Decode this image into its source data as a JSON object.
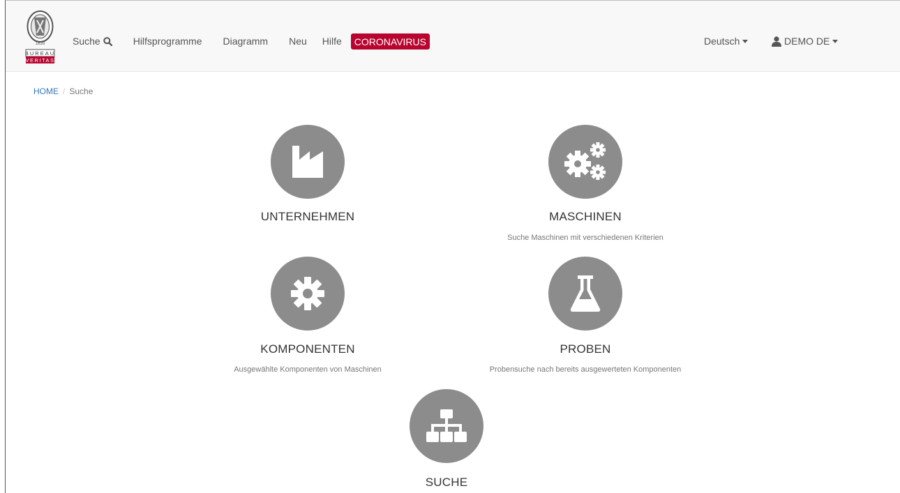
{
  "brand": {
    "logo_top_text": "BUREAU",
    "logo_bottom_text": "VERITAS",
    "logo_year": "1828"
  },
  "nav": {
    "items": [
      {
        "label": "Suche",
        "icon": "search-icon"
      },
      {
        "label": "Hilfsprogramme"
      },
      {
        "label": "Diagramm"
      },
      {
        "label": "Neu"
      },
      {
        "label": "Hilfe"
      }
    ],
    "highlight_label": "CORONAVIRUS",
    "language": "Deutsch",
    "user": "DEMO DE"
  },
  "breadcrumb": {
    "home": "HOME",
    "separator": "/",
    "current": "Suche"
  },
  "tiles": [
    {
      "title": "UNTERNEHMEN",
      "description": "",
      "icon": "factory-icon"
    },
    {
      "title": "MASCHINEN",
      "description": "Suche Maschinen mit verschiedenen Kriterien",
      "icon": "gears-icon"
    },
    {
      "title": "KOMPONENTEN",
      "description": "Ausgewählte Komponenten von Maschinen",
      "icon": "gear-icon"
    },
    {
      "title": "PROBEN",
      "description": "Probensuche nach bereits ausgewerteten Komponenten",
      "icon": "flask-icon"
    },
    {
      "title": "SUCHE",
      "description": "",
      "icon": "sitemap-icon"
    }
  ],
  "colors": {
    "accent": "#b8042f",
    "tile_circle": "#8c8c8c",
    "link": "#337ab7"
  }
}
